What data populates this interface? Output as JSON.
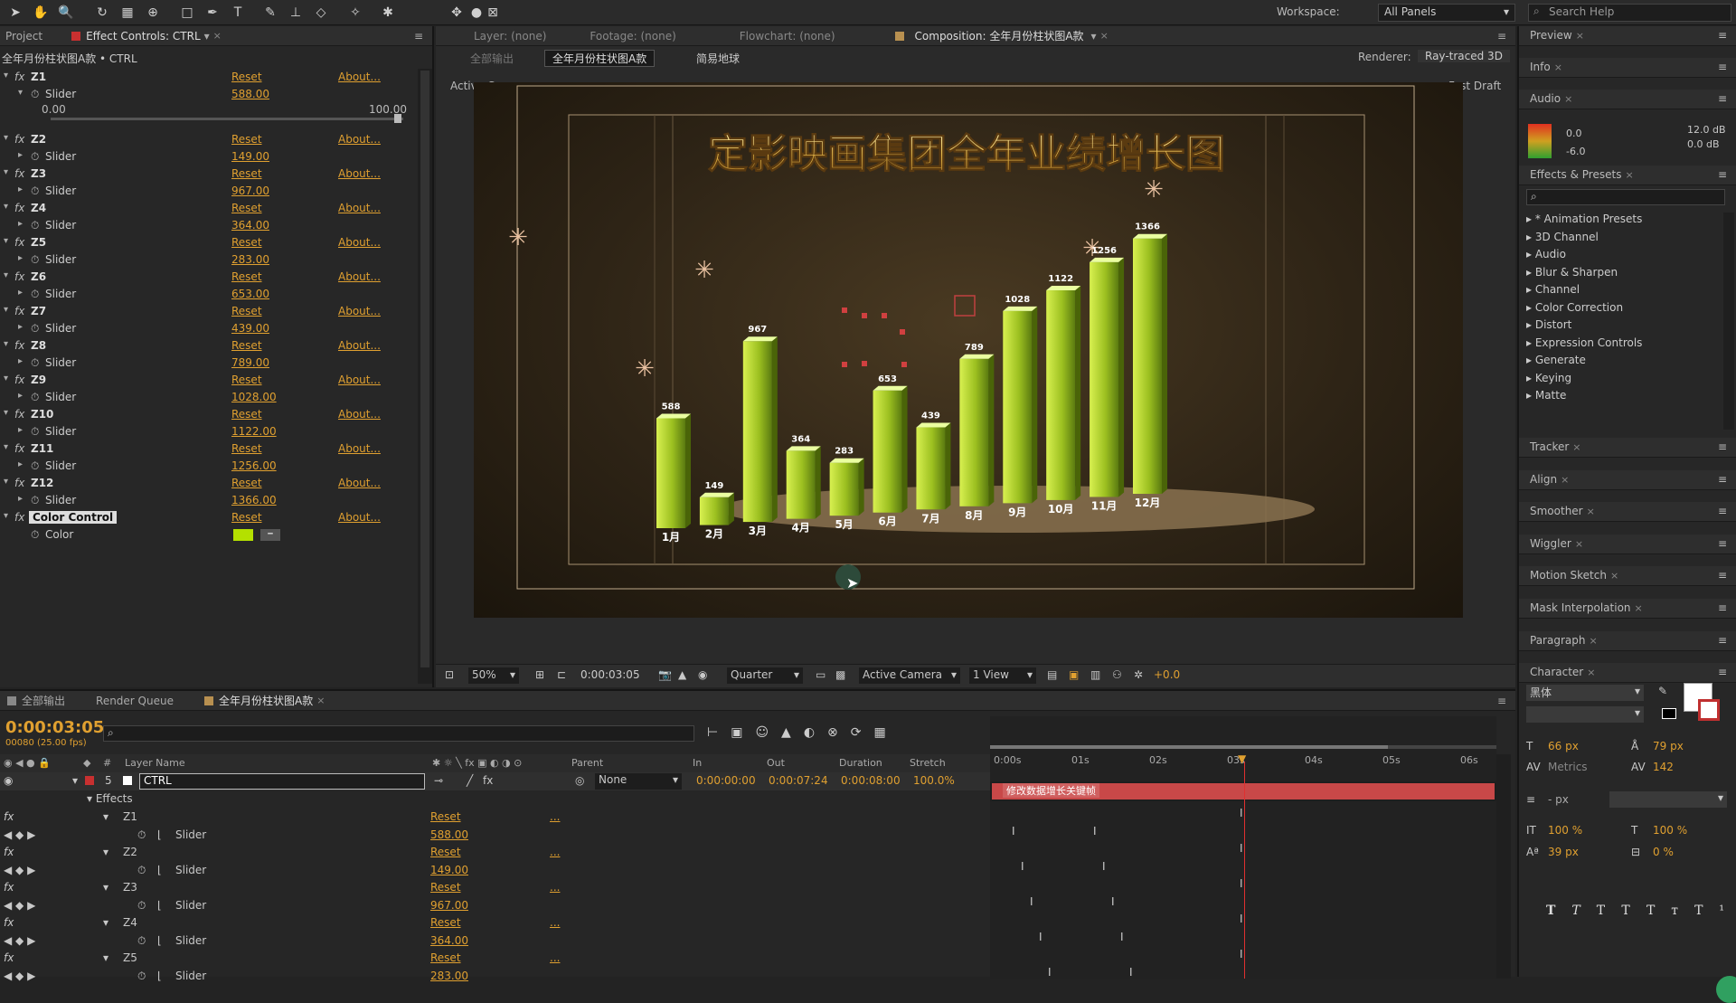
{
  "workspace": {
    "label": "Workspace:",
    "value": "All Panels"
  },
  "search_help": {
    "placeholder": "Search Help"
  },
  "project_panel": {
    "tab_project": "Project",
    "tab_effect_controls": "Effect Controls: CTRL",
    "breadcrumb": "全年月份柱状图A款 • CTRL",
    "z1_slider_min": "0.00",
    "z1_slider_max": "100.00",
    "reset_label": "Reset",
    "about_label": "About...",
    "slider_label": "Slider",
    "effects": [
      {
        "name": "Z1",
        "value": "588.00"
      },
      {
        "name": "Z2",
        "value": "149.00"
      },
      {
        "name": "Z3",
        "value": "967.00"
      },
      {
        "name": "Z4",
        "value": "364.00"
      },
      {
        "name": "Z5",
        "value": "283.00"
      },
      {
        "name": "Z6",
        "value": "653.00"
      },
      {
        "name": "Z7",
        "value": "439.00"
      },
      {
        "name": "Z8",
        "value": "789.00"
      },
      {
        "name": "Z9",
        "value": "1028.00"
      },
      {
        "name": "Z10",
        "value": "1122.00"
      },
      {
        "name": "Z11",
        "value": "1256.00"
      },
      {
        "name": "Z12",
        "value": "1366.00"
      }
    ],
    "color_control": {
      "name": "Color Control",
      "prop": "Color",
      "swatch": "#b4e000"
    }
  },
  "viewer": {
    "tab_layer": "Layer: (none)",
    "tab_footage": "Footage: (none)",
    "tab_flowchart": "Flowchart: (none)",
    "tab_composition": "Composition: 全年月份柱状图A款",
    "crumbs": [
      "全部输出",
      "全年月份柱状图A款",
      "简易地球"
    ],
    "renderer_label": "Renderer:",
    "renderer_value": "Ray-traced 3D",
    "active_camera": "Active Camera",
    "fast_draft": "Fast Draft",
    "comp_title": "定影映画集团全年业绩增长图",
    "zoom": "50%",
    "timecode": "0:00:03:05",
    "resolution": "Quarter",
    "camera": "Active Camera",
    "views": "1 View",
    "exposure": "+0.0",
    "accent": "#f0d070"
  },
  "chart_data": {
    "type": "bar",
    "title": "定影映画集团全年业绩增长图",
    "categories": [
      "1月",
      "2月",
      "3月",
      "4月",
      "5月",
      "6月",
      "7月",
      "8月",
      "9月",
      "10月",
      "11月",
      "12月"
    ],
    "values": [
      588,
      149,
      967,
      364,
      283,
      653,
      439,
      789,
      1028,
      1122,
      1256,
      1366
    ],
    "ylim": [
      0,
      1500
    ],
    "bar_color": "#b4e000"
  },
  "right_panel": {
    "preview": "Preview",
    "info": "Info",
    "audio": "Audio",
    "audio_vals": [
      "0.0",
      "12.0 dB",
      "0.0 dB",
      "-6.0"
    ],
    "effects_presets": "Effects & Presets",
    "effects_list": [
      "* Animation Presets",
      "3D Channel",
      "Audio",
      "Blur & Sharpen",
      "Channel",
      "Color Correction",
      "Distort",
      "Expression Controls",
      "Generate",
      "Keying",
      "Matte"
    ],
    "panels": [
      "Tracker",
      "Align",
      "Smoother",
      "Wiggler",
      "Motion Sketch",
      "Mask Interpolation",
      "Paragraph",
      "Character"
    ],
    "character": {
      "font": "黑体",
      "font_size": "66 px",
      "leading": "79 px",
      "kerning": "Metrics",
      "tracking": "142",
      "stroke": "- px",
      "vscale": "100 %",
      "hscale": "100 %",
      "baseline": "39 px",
      "tsume": "0 %"
    }
  },
  "timeline": {
    "tabs": [
      "全部输出",
      "Render Queue",
      "全年月份柱状图A款"
    ],
    "timecode": "0:00:03:05",
    "fps": "00080 (25.00 fps)",
    "columns": [
      "#",
      "Layer Name",
      "Parent",
      "In",
      "Out",
      "Duration",
      "Stretch"
    ],
    "ruler": [
      "0:00s",
      "01s",
      "02s",
      "03s",
      "04s",
      "05s",
      "06s"
    ],
    "layer": {
      "num": "5",
      "name": "CTRL",
      "parent": "None",
      "in": "0:00:00:00",
      "out": "0:00:07:24",
      "duration": "0:00:08:00",
      "stretch": "100.0%",
      "bar_label": "修改数据增长关键帧"
    },
    "effects_label": "Effects",
    "rows": [
      {
        "name": "Z1",
        "value": "588.00"
      },
      {
        "name": "Z2",
        "value": "149.00"
      },
      {
        "name": "Z3",
        "value": "967.00"
      },
      {
        "name": "Z4",
        "value": "364.00"
      },
      {
        "name": "Z5",
        "value": "283.00"
      }
    ],
    "reset_label": "Reset",
    "dots_label": "...",
    "slider_label": "Slider"
  }
}
